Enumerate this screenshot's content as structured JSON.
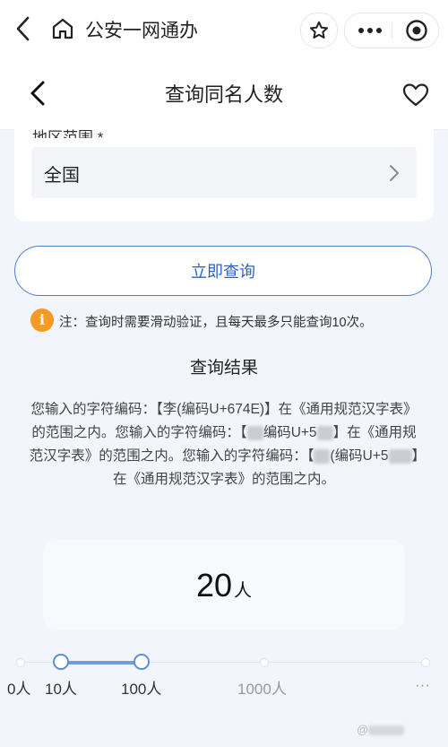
{
  "topbar": {
    "app_title": "公安一网通办",
    "icons": [
      "back-icon",
      "home-icon",
      "star-icon",
      "more-icon",
      "target-icon"
    ]
  },
  "header": {
    "title": "查询同名人数",
    "icons": [
      "back-icon",
      "heart-icon"
    ]
  },
  "form": {
    "region_label": "地区范围 *",
    "region_value": "全国"
  },
  "query_button": "立即查询",
  "note": {
    "icon_text": "i",
    "text": "注：查询时需要滑动验证，且每天最多只能查询10次。"
  },
  "result": {
    "title": "查询结果",
    "p1": "您输入的字符编码：【李(编码U+674E)】在《通用规范汉字表》的范围之内。您输入的字符编码：【",
    "p2": "编码U+5",
    "p3": "】在《通用规范汉字表》的范围之内。您输入的字符编码：【",
    "p4": "(编码U+5",
    "p5": "】在《通用规范汉字表》的范围之内。",
    "count_value": "20",
    "count_unit": "人"
  },
  "slider": {
    "ticks": [
      "0人",
      "10人",
      "100人",
      "1000人",
      "···"
    ],
    "selected_min": "10人",
    "selected_max": "100人",
    "accent": "#5b8ee0"
  },
  "watermark": "@"
}
